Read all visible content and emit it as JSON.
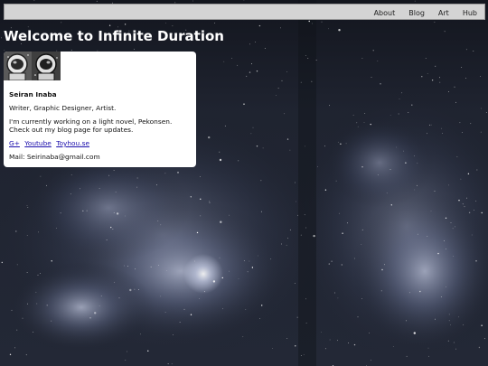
{
  "nav": {
    "items": [
      {
        "label": "About"
      },
      {
        "label": "Blog"
      },
      {
        "label": "Art"
      },
      {
        "label": "Hub"
      }
    ]
  },
  "header": {
    "title": "Welcome to Infinite Duration"
  },
  "profile": {
    "avatar_icons": [
      "astronaut-helmet-icon",
      "astronaut-helmet-icon"
    ],
    "name": "Seiran Inaba",
    "roles": "Writer, Graphic Designer, Artist.",
    "bio": "I'm currently working on a light novel, Pekonsen. Check out my blog page for updates.",
    "links": [
      {
        "label": "G+"
      },
      {
        "label": "Youtube"
      },
      {
        "label": "Toyhou.se"
      }
    ],
    "email": "Mail: Seirinaba@gmail.com"
  },
  "colors": {
    "topbar_bg": "#d4d4d4",
    "title_text": "#ffffff",
    "card_bg": "#ffffff",
    "link": "#1a0dab",
    "space_bg": "#1a1e28"
  }
}
